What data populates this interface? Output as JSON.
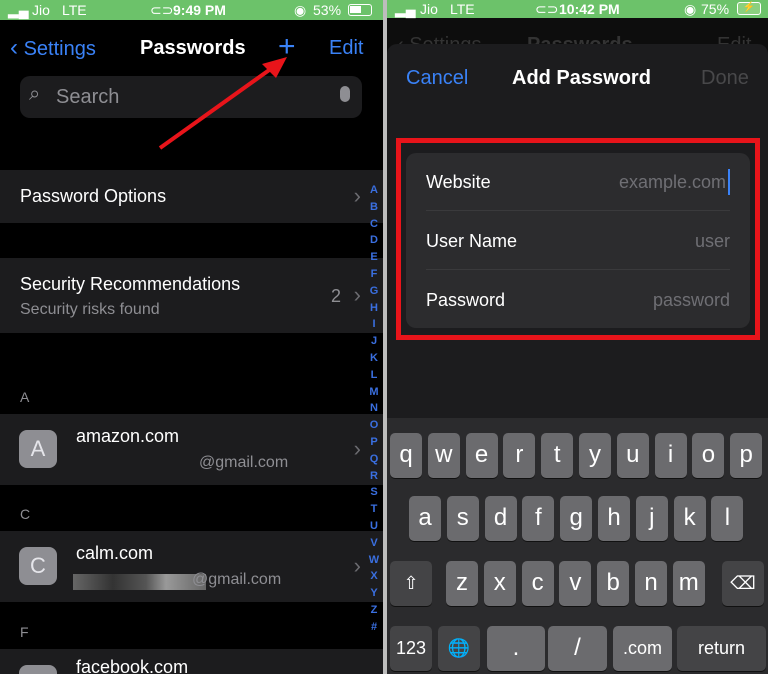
{
  "left": {
    "status": {
      "carrier": "Jio",
      "network": "LTE",
      "time": "9:49 PM",
      "battery": "53%"
    },
    "nav": {
      "back_label": "Settings",
      "title": "Passwords",
      "add_icon": "plus-icon",
      "edit_label": "Edit"
    },
    "search": {
      "placeholder": "Search"
    },
    "password_options": "Password Options",
    "security": {
      "title": "Security Recommendations",
      "subtitle": "Security risks found",
      "count": "2"
    },
    "sections": [
      {
        "letter": "A",
        "site": "amazon.com",
        "account": "@gmail.com",
        "avatar": "A"
      },
      {
        "letter": "C",
        "site": "calm.com",
        "account": "@gmail.com",
        "avatar": "C"
      },
      {
        "letter": "F",
        "site": "facebook.com",
        "avatar": ""
      }
    ],
    "index": [
      "A",
      "B",
      "C",
      "D",
      "E",
      "F",
      "G",
      "H",
      "I",
      "J",
      "K",
      "L",
      "M",
      "N",
      "O",
      "P",
      "Q",
      "R",
      "S",
      "T",
      "U",
      "V",
      "W",
      "X",
      "Y",
      "Z",
      "#"
    ]
  },
  "right": {
    "status": {
      "carrier": "Jio",
      "network": "LTE",
      "time": "10:42 PM",
      "battery": "75%"
    },
    "background_nav": {
      "back_label": "Settings",
      "title": "Passwords",
      "edit_label": "Edit"
    },
    "sheet": {
      "cancel_label": "Cancel",
      "title": "Add Password",
      "done_label": "Done"
    },
    "fields": [
      {
        "label": "Website",
        "placeholder": "example.com"
      },
      {
        "label": "User Name",
        "placeholder": "user"
      },
      {
        "label": "Password",
        "placeholder": "password"
      }
    ],
    "keyboard": {
      "row1": [
        "q",
        "w",
        "e",
        "r",
        "t",
        "y",
        "u",
        "i",
        "o",
        "p"
      ],
      "row2": [
        "a",
        "s",
        "d",
        "f",
        "g",
        "h",
        "j",
        "k",
        "l"
      ],
      "row3": [
        "z",
        "x",
        "c",
        "v",
        "b",
        "n",
        "m"
      ],
      "numbers_label": "123",
      "dot": ".",
      "slash": "/",
      "dotcom": ".com",
      "return_label": "return"
    }
  },
  "colors": {
    "accent": "#3a82f7",
    "highlight": "#e8141a",
    "status_bar": "#6cc26a"
  }
}
